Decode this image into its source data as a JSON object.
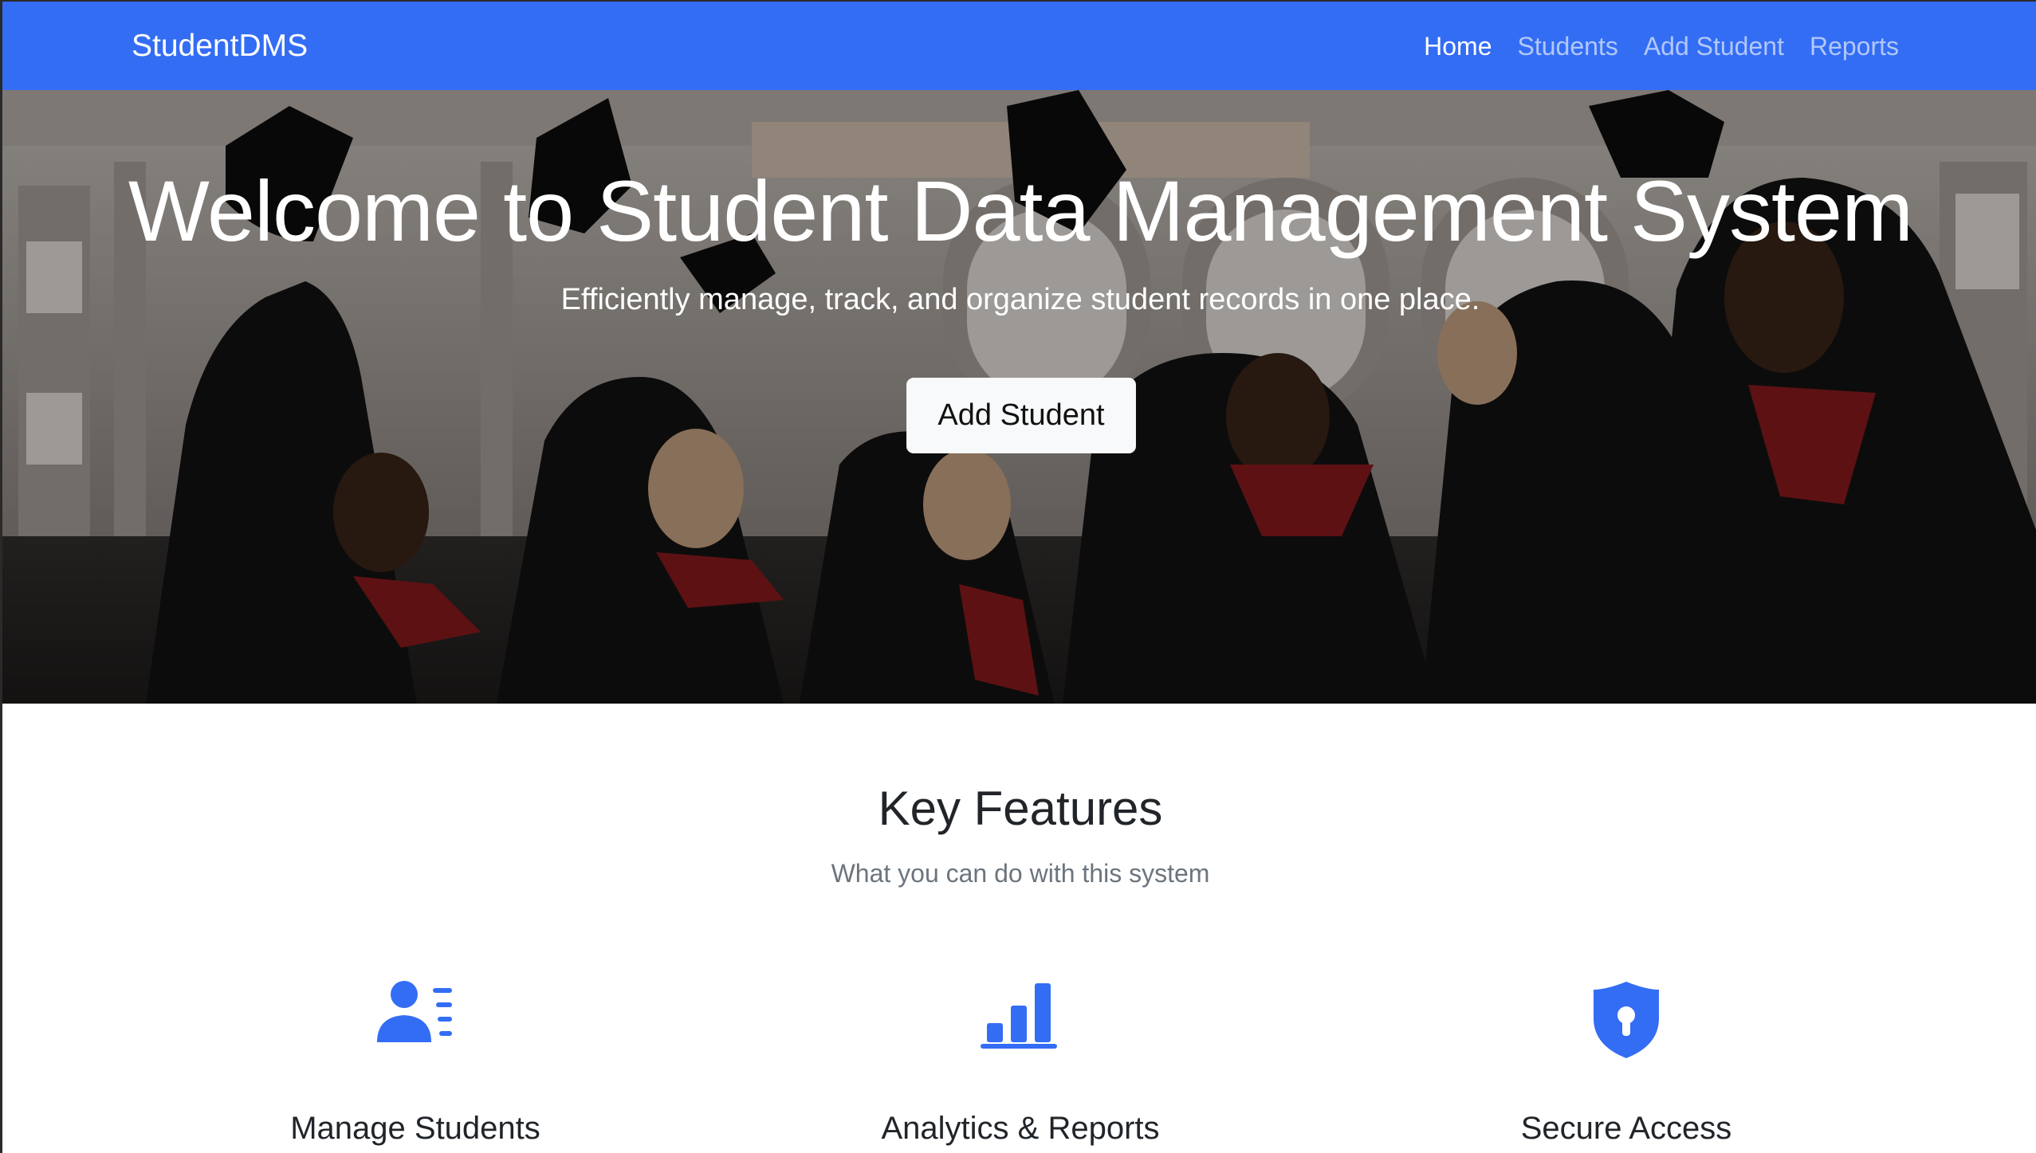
{
  "navbar": {
    "brand": "StudentDMS",
    "links": [
      {
        "label": "Home",
        "active": true
      },
      {
        "label": "Students",
        "active": false
      },
      {
        "label": "Add Student",
        "active": false
      },
      {
        "label": "Reports",
        "active": false
      }
    ]
  },
  "hero": {
    "title": "Welcome to Student Data Management System",
    "subtitle": "Efficiently manage, track, and organize student records in one place.",
    "button_label": "Add Student"
  },
  "features": {
    "title": "Key Features",
    "subtitle": "What you can do with this system",
    "items": [
      {
        "title": "Manage Students",
        "icon": "user-list-icon"
      },
      {
        "title": "Analytics & Reports",
        "icon": "bar-chart-icon"
      },
      {
        "title": "Secure Access",
        "icon": "shield-lock-icon"
      }
    ]
  },
  "colors": {
    "primary": "#336df4",
    "navbar_bg": "#336df4",
    "button_bg": "#f8f9fa",
    "heading": "#212529",
    "muted": "#6c757d"
  }
}
